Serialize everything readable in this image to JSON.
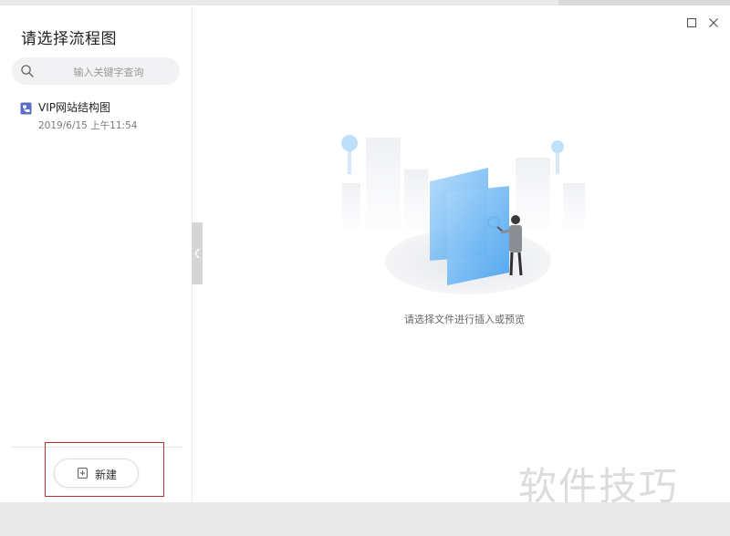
{
  "sidebar": {
    "title": "请选择流程图",
    "search": {
      "placeholder": "输入关键字查询",
      "value": ""
    },
    "items": [
      {
        "name": "VIP网站结构图",
        "date": "2019/6/15 上午11:54",
        "icon": "flowchart-file-icon"
      }
    ],
    "new_button": {
      "label": "新建",
      "icon": "new-file-icon"
    }
  },
  "window_controls": {
    "maximize_icon": "maximize-icon",
    "close_icon": "close-icon"
  },
  "main": {
    "empty_text": "请选择文件进行插入或预览"
  },
  "watermark": "软件技巧",
  "colors": {
    "accent_blue": "#5aaef0",
    "highlight_red": "#b0342f",
    "sidebar_bg": "#ffffff"
  }
}
